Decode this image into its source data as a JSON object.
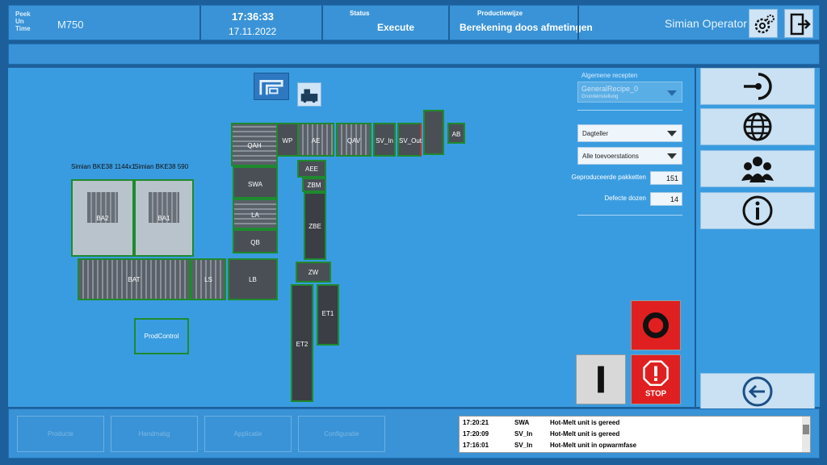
{
  "header": {
    "logo_lines": [
      "Peek",
      "Un",
      "Time"
    ],
    "model": "M750",
    "time": "17:36:33",
    "date": "17.11.2022",
    "status_label": "Status",
    "status_value": "Execute",
    "mode_label": "Productiewijze",
    "mode_value": "Berekening doos afmetingen",
    "user": "Simian Operator"
  },
  "layout": {
    "modules": {
      "qah": "QAH",
      "wp": "WP",
      "ae": "AE",
      "qav": "QAV",
      "sv_in": "SV_In",
      "sv_out": "SV_Out",
      "ab": "AB",
      "aee": "AEE",
      "zbm": "ZBM",
      "swa": "SWA",
      "la": "LA",
      "qb": "QB",
      "zbe": "ZBE",
      "lb": "LB",
      "ls": "LS",
      "bat": "BAT",
      "zw": "ZW",
      "ba2": "BA2",
      "ba1": "BA1",
      "et1": "ET1",
      "et2": "ET2"
    },
    "machine_label_1": "Simian BKE38 1144x1",
    "machine_label_2": "Simian BKE38 590",
    "prodcontrol": "ProdControl"
  },
  "settings": {
    "recipes_title": "Algemene recepten",
    "recipe_name": "GeneralRecipe_0",
    "recipe_sub": "Grundeinstellung",
    "counter_select": "Dagteller",
    "station_select": "Alle toevoerstations",
    "produced_label": "Geproduceerde pakketten",
    "produced_value": "151",
    "defects_label": "Defecte dozen",
    "defects_value": "14"
  },
  "controls": {
    "stop_label": "STOP"
  },
  "bottom_tabs": [
    "Producte",
    "Handmatig",
    "Applicatie",
    "Configuratie"
  ],
  "log": [
    {
      "time": "17:20:21",
      "station": "SWA",
      "message": "Hot-Melt unit is gereed"
    },
    {
      "time": "17:20:09",
      "station": "SV_In",
      "message": "Hot-Melt unit is gereed"
    },
    {
      "time": "17:16:01",
      "station": "SV_In",
      "message": "Hot-Melt unit in opwarmfase"
    }
  ],
  "icons": {
    "settings": "gear-icon",
    "logout": "exit-door-icon",
    "login_key": "key-icon",
    "language": "globe-icon",
    "users": "users-icon",
    "info": "info-icon",
    "back": "back-arrow-icon"
  },
  "colors": {
    "panel_blue": "#3a9ce0",
    "module_border": "#1e8a2e",
    "stop_red": "#e02020"
  }
}
